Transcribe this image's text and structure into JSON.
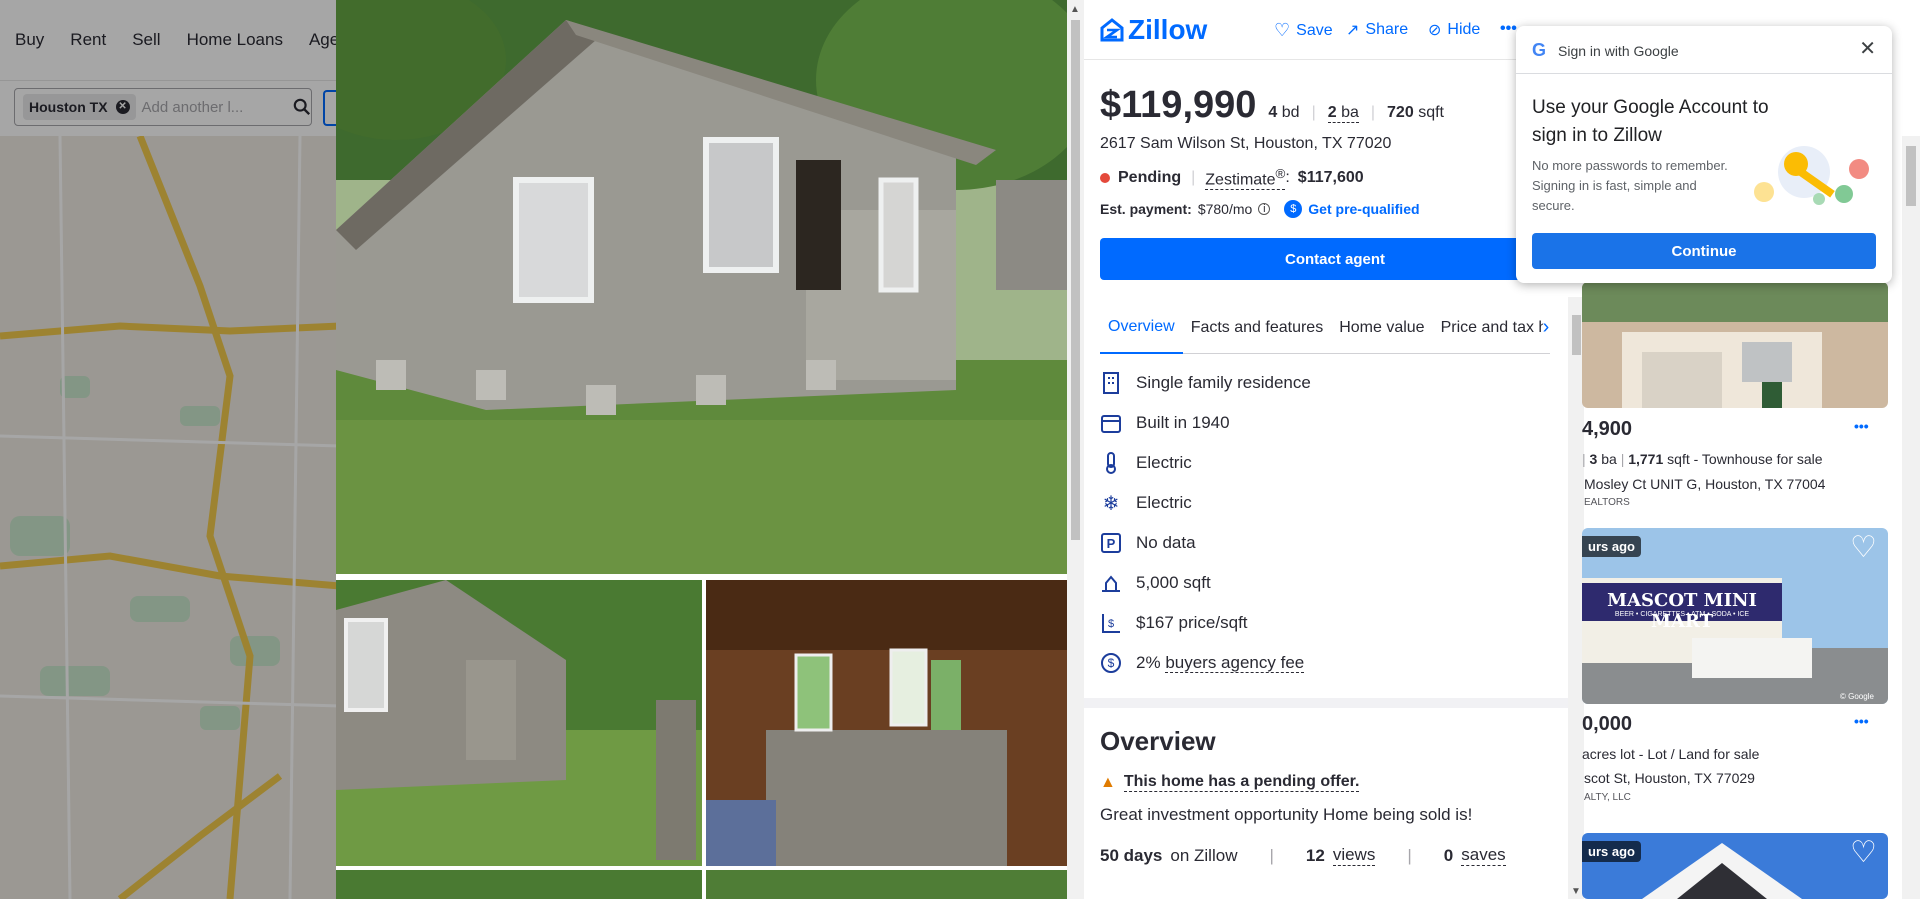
{
  "nav": {
    "items": [
      "Buy",
      "Rent",
      "Sell",
      "Home Loans",
      "Age"
    ]
  },
  "search": {
    "chip": "Houston TX",
    "placeholder": "Add another l..."
  },
  "details": {
    "logo": "Zillow",
    "actions": {
      "save": "Save",
      "share": "Share",
      "hide": "Hide"
    },
    "price": "$119,990",
    "beds_num": "4",
    "beds_label": "bd",
    "baths_num": "2",
    "baths_label": "ba",
    "sqft_num": "720",
    "sqft_label": "sqft",
    "address": "2617 Sam Wilson St, Houston, TX 77020",
    "status": "Pending",
    "zestimate_label": "Zestimate",
    "zestimate_mark": "®",
    "zestimate_value": "$117,600",
    "est_payment_label": "Est. payment:",
    "est_payment_value": "$780/mo",
    "prequal": "Get pre-qualified",
    "contact": "Contact agent",
    "tabs": [
      "Overview",
      "Facts and features",
      "Home value",
      "Price and tax h"
    ],
    "features": [
      {
        "icon": "building-icon",
        "text": "Single family residence"
      },
      {
        "icon": "calendar-icon",
        "text": "Built in 1940"
      },
      {
        "icon": "thermometer-icon",
        "text": "Electric"
      },
      {
        "icon": "snowflake-icon",
        "text": "Electric"
      },
      {
        "icon": "parking-icon",
        "text": "No data"
      },
      {
        "icon": "lot-icon",
        "text": "5,000 sqft"
      },
      {
        "icon": "price-sqft-icon",
        "text": "$167 price/sqft"
      },
      {
        "icon": "dollar-circle-icon",
        "text": "2%",
        "link": "buyers agency fee"
      }
    ],
    "overview_title": "Overview",
    "pending_notice": "This home has a pending offer.",
    "description": "Great investment opportunity Home being sold is!",
    "stats": {
      "days": "50 days",
      "days_label": "on Zillow",
      "views": "12",
      "views_label": "views",
      "saves": "0",
      "saves_label": "saves"
    }
  },
  "listings": [
    {
      "price": "4,900",
      "bath_num": "3",
      "bath_label": "ba",
      "sqft_num": "1,771",
      "sqft_label": "sqft",
      "type": "- Townhouse for sale",
      "address": "Mosley Ct UNIT G, Houston, TX 77004",
      "broker": "EALTORS"
    },
    {
      "badge": "urs ago",
      "price": "0,000",
      "detail": "acres lot - Lot / Land for sale",
      "address": "scot St, Houston, TX 77029",
      "broker": "ALTY, LLC",
      "store_sign": "MASCOT MINI MART",
      "store_sub": "BEER • CIGARETTES • ATM • SODA • ICE",
      "watermark": "© Google"
    },
    {
      "badge": "urs ago"
    }
  ],
  "google": {
    "header": "Sign in with Google",
    "title": "Use your Google Account to sign in to Zillow",
    "body": "No more passwords to remember. Signing in is fast, simple and secure.",
    "continue": "Continue"
  },
  "colors": {
    "brand": "#006aff",
    "pending": "#e4493b",
    "google_blue": "#1a73e8"
  }
}
